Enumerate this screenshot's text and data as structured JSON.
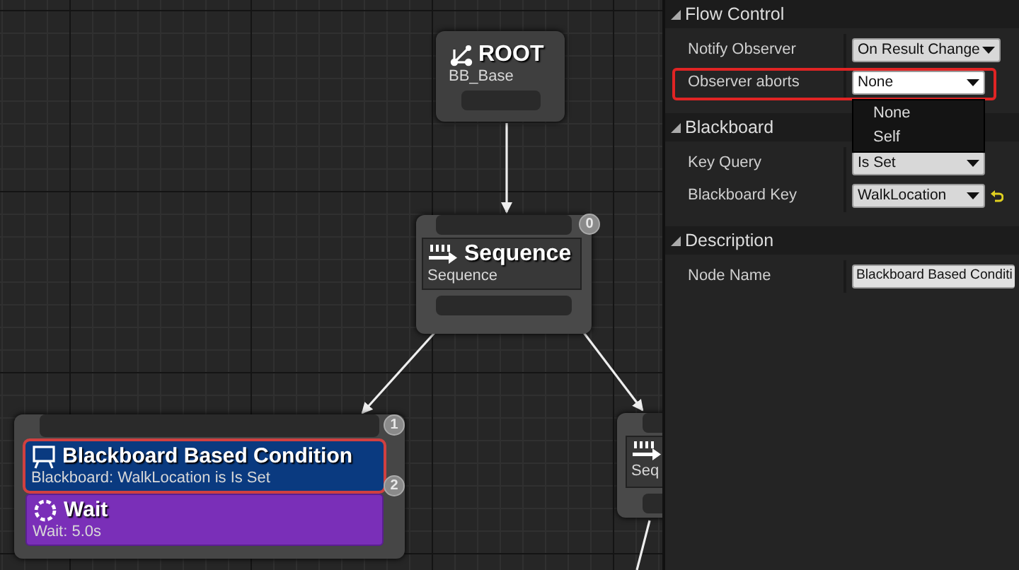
{
  "graph": {
    "nodes": [
      {
        "kind": "root",
        "title": "ROOT",
        "subtitle": "BB_Base"
      },
      {
        "kind": "composite",
        "title": "Sequence",
        "subtitle": "Sequence",
        "badge": "0"
      },
      {
        "kind": "group",
        "badge": "1",
        "decorators": [
          {
            "title": "Blackboard Based Condition",
            "subtitle": "Blackboard: WalkLocation is Is Set",
            "badge": "2",
            "selected": true
          }
        ],
        "tasks": [
          {
            "title": "Wait",
            "subtitle": "Wait: 5.0s"
          }
        ]
      },
      {
        "kind": "partial",
        "subtitle": "Seq"
      }
    ]
  },
  "details": {
    "sections": [
      {
        "title": "Flow Control",
        "rows": [
          {
            "kind": "combo",
            "label": "Notify Observer",
            "value": "On Result Change",
            "selected": false
          },
          {
            "kind": "combo",
            "label": "Observer aborts",
            "value": "None",
            "selected": true,
            "expanded": true,
            "options": [
              "None",
              "Self"
            ]
          }
        ]
      },
      {
        "title": "Blackboard",
        "rows": [
          {
            "kind": "combo",
            "label": "Key Query",
            "value": "Is Set",
            "selected": false
          },
          {
            "kind": "combo-reset",
            "label": "Blackboard Key",
            "value": "WalkLocation",
            "selected": false
          }
        ]
      },
      {
        "title": "Description",
        "rows": [
          {
            "kind": "text",
            "label": "Node Name",
            "value": "Blackboard Based Conditi",
            "selected": false
          }
        ]
      }
    ]
  }
}
